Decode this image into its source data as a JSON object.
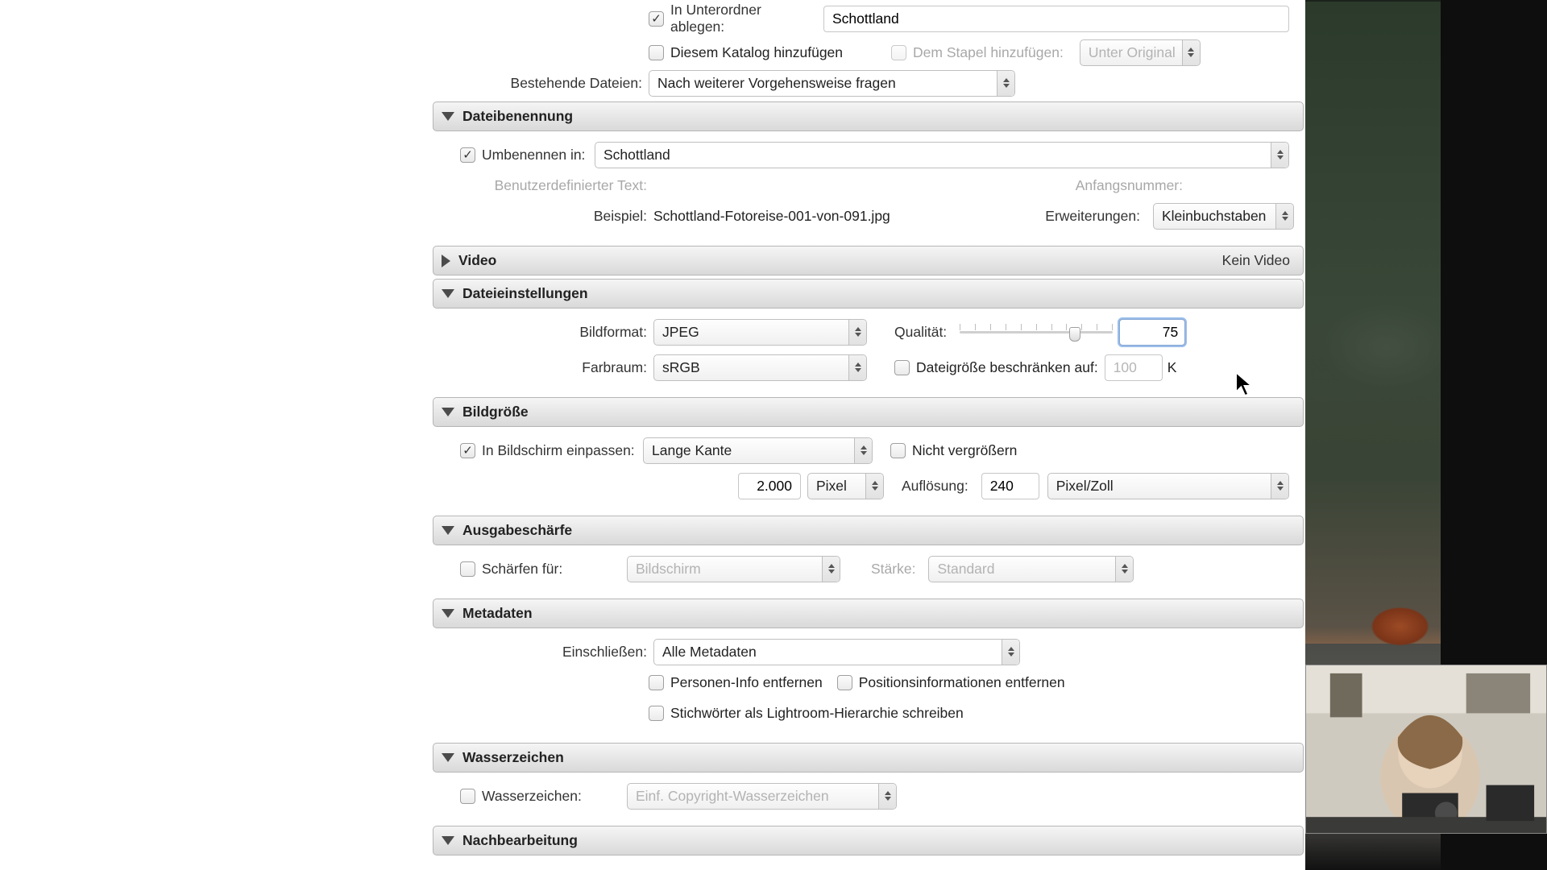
{
  "top": {
    "subfolder_label": "In Unterordner ablegen:",
    "subfolder_value": "Schottland",
    "add_catalog_label": "Diesem Katalog hinzufügen",
    "add_stack_label": "Dem Stapel hinzufügen:",
    "stack_select": "Unter Original",
    "existing_label": "Bestehende Dateien:",
    "existing_value": "Nach weiterer Vorgehensweise fragen"
  },
  "naming": {
    "header": "Dateibenennung",
    "rename_label": "Umbenennen in:",
    "rename_value": "Schottland",
    "custom_text_label": "Benutzerdefinierter Text:",
    "start_num_label": "Anfangsnummer:",
    "example_label": "Beispiel:",
    "example_value": "Schottland-Fotoreise-001-von-091.jpg",
    "ext_label": "Erweiterungen:",
    "ext_value": "Kleinbuchstaben"
  },
  "video": {
    "header": "Video",
    "right": "Kein Video"
  },
  "fileset": {
    "header": "Dateieinstellungen",
    "format_label": "Bildformat:",
    "format_value": "JPEG",
    "quality_label": "Qualität:",
    "quality_value": "75",
    "color_label": "Farbraum:",
    "color_value": "sRGB",
    "limit_label": "Dateigröße beschränken auf:",
    "limit_value": "100",
    "limit_unit": "K"
  },
  "size": {
    "header": "Bildgröße",
    "fit_label": "In Bildschirm einpassen:",
    "fit_value": "Lange Kante",
    "noenlarge_label": "Nicht vergrößern",
    "dim_value": "2.000",
    "dim_unit": "Pixel",
    "res_label": "Auflösung:",
    "res_value": "240",
    "res_unit": "Pixel/Zoll"
  },
  "sharpen": {
    "header": "Ausgabeschärfe",
    "for_label": "Schärfen für:",
    "for_value": "Bildschirm",
    "amount_label": "Stärke:",
    "amount_value": "Standard"
  },
  "meta": {
    "header": "Metadaten",
    "include_label": "Einschließen:",
    "include_value": "Alle Metadaten",
    "remove_people": "Personen-Info entfernen",
    "remove_location": "Positionsinformationen entfernen",
    "keywords_hierarchy": "Stichwörter als Lightroom-Hierarchie schreiben"
  },
  "wm": {
    "header": "Wasserzeichen",
    "label": "Wasserzeichen:",
    "value": "Einf. Copyright-Wasserzeichen"
  },
  "post": {
    "header": "Nachbearbeitung"
  }
}
